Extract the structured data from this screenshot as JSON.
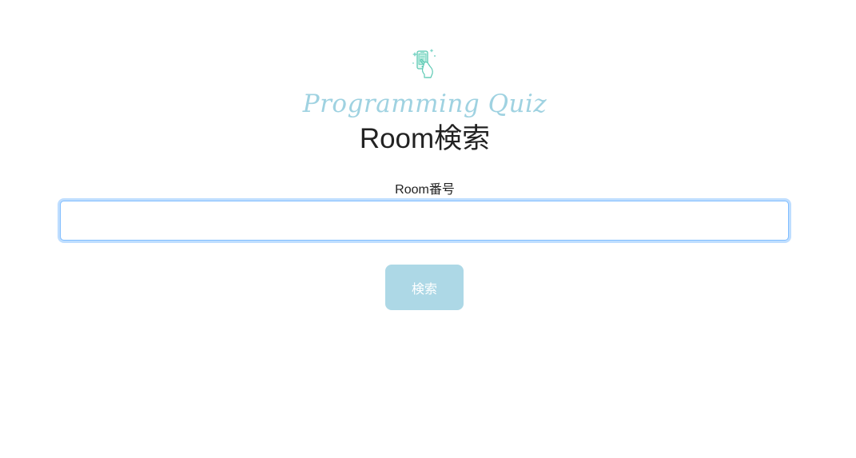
{
  "header": {
    "logo_icon": "phone-with-hand-icon",
    "logo_text": "Programming Quiz",
    "title": "Room検索"
  },
  "form": {
    "room_number_label": "Room番号",
    "room_number_value": "",
    "room_number_placeholder": "",
    "search_button_label": "検索"
  },
  "colors": {
    "brand_light_blue": "#add8e6",
    "logo_text": "#9fd2e1",
    "input_focus_border": "#80bdff",
    "text": "#222222",
    "background": "#ffffff"
  }
}
